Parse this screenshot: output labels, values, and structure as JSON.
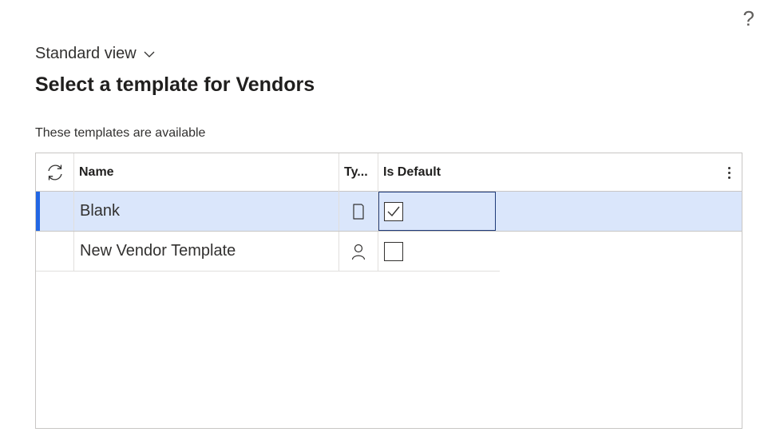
{
  "help": {
    "label": "?"
  },
  "view": {
    "label": "Standard view"
  },
  "title": "Select a template for Vendors",
  "subtitle": "These templates are available",
  "grid": {
    "columns": {
      "name": "Name",
      "type": "Ty...",
      "is_default": "Is Default"
    },
    "rows": [
      {
        "name": "Blank",
        "type_icon": "document-icon",
        "is_default": true,
        "selected": true
      },
      {
        "name": "New Vendor Template",
        "type_icon": "person-icon",
        "is_default": false,
        "selected": false
      }
    ]
  },
  "colors": {
    "accent": "#2266e3",
    "selected_row": "#dae6fb",
    "focus_border": "#1f3b7a"
  }
}
